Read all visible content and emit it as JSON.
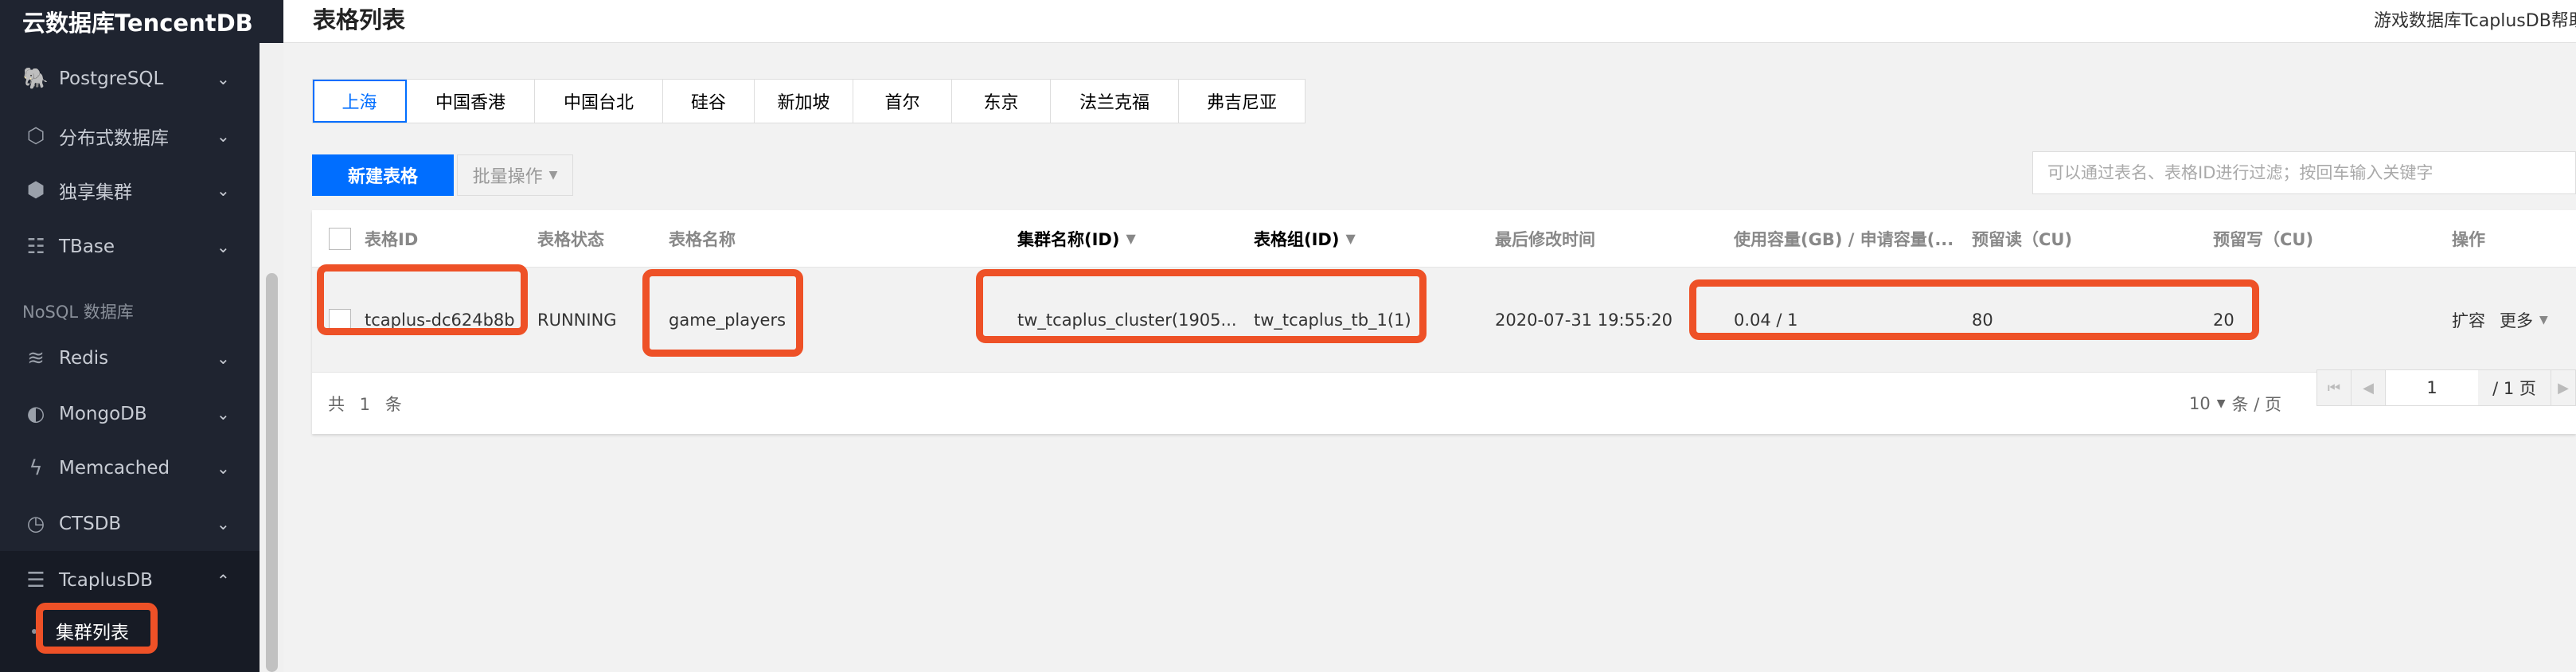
{
  "sidebar": {
    "brand": "云数据库TencentDB",
    "items": [
      {
        "label": "PostgreSQL",
        "icon": "elephant-icon",
        "glyph": "🐘"
      },
      {
        "label": "分布式数据库",
        "icon": "hexagon-network-icon",
        "glyph": "⬡"
      },
      {
        "label": "独享集群",
        "icon": "hexagon-ring-icon",
        "glyph": "⬢"
      },
      {
        "label": "TBase",
        "icon": "database-table-icon",
        "glyph": "☷"
      }
    ],
    "group_label": "NoSQL 数据库",
    "nosql_items": [
      {
        "label": "Redis",
        "icon": "layers-icon",
        "glyph": "≋"
      },
      {
        "label": "MongoDB",
        "icon": "leaf-icon",
        "glyph": "◐"
      },
      {
        "label": "Memcached",
        "icon": "lightning-icon",
        "glyph": "ϟ"
      },
      {
        "label": "CTSDB",
        "icon": "clock-icon",
        "glyph": "◷"
      },
      {
        "label": "TcaplusDB",
        "icon": "database-icon",
        "glyph": "☰"
      }
    ],
    "sub_item": "集群列表"
  },
  "header": {
    "title": "表格列表",
    "help": "游戏数据库TcaplusDB帮助"
  },
  "regions": [
    "上海",
    "中国香港",
    "中国台北",
    "硅谷",
    "新加坡",
    "首尔",
    "东京",
    "法兰克福",
    "弗吉尼亚"
  ],
  "toolbar": {
    "new_label": "新建表格",
    "batch_label": "批量操作",
    "search_placeholder": "可以通过表名、表格ID进行过滤；按回车输入关键字"
  },
  "table": {
    "columns": [
      "表格ID",
      "表格状态",
      "表格名称",
      "集群名称(ID)",
      "表格组(ID)",
      "最后修改时间",
      "使用容量(GB) / 申请容量(...",
      "预留读（CU)",
      "预留写（CU)",
      "操作"
    ],
    "row": {
      "id": "tcaplus-dc624b8b",
      "status": "RUNNING",
      "name": "game_players",
      "cluster": "tw_tcaplus_cluster(1905...",
      "group": "tw_tcaplus_tb_1(1)",
      "modified": "2020-07-31 19:55:20",
      "capacity": "0.04 / 1",
      "read_cu": "80",
      "write_cu": "20",
      "action_expand": "扩容",
      "action_more": "更多"
    }
  },
  "footer": {
    "total": "共 1 条",
    "page_size": "10",
    "per_page_label": "条 / 页",
    "current_page": "1",
    "total_pages": "/ 1 页"
  },
  "colors": {
    "accent": "#006eff",
    "highlight": "#ee5127",
    "sidebar": "#1f2430"
  }
}
